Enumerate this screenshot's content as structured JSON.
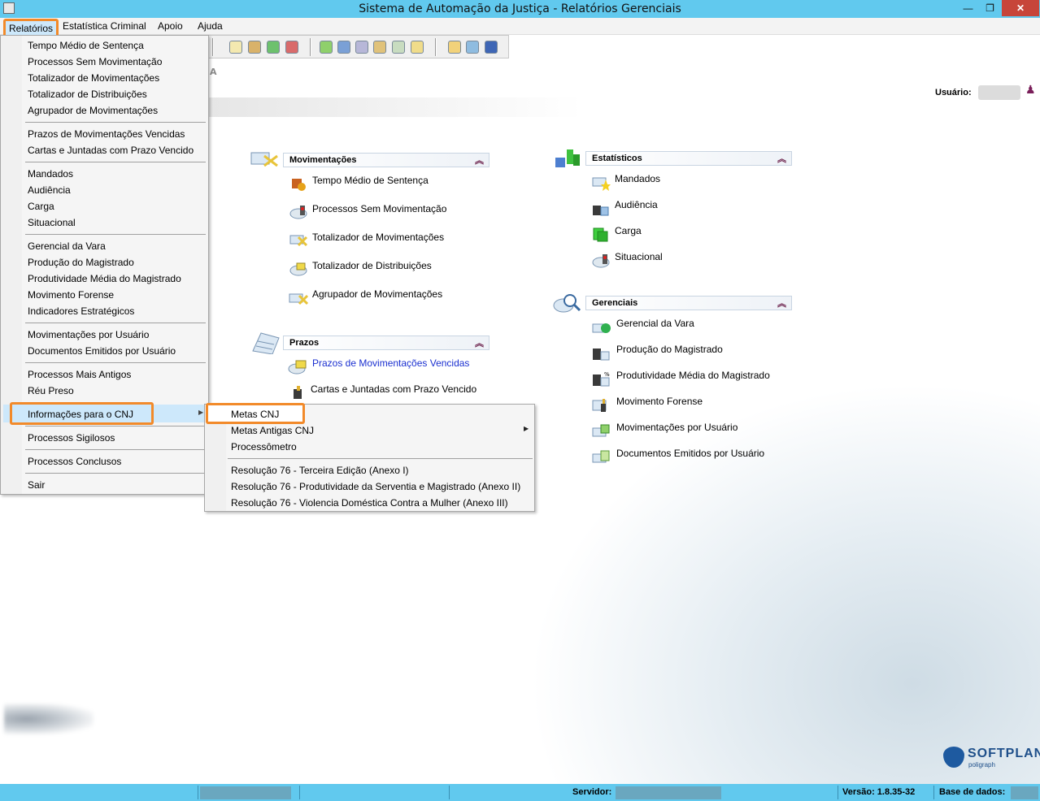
{
  "window": {
    "title": "Sistema de Automação da Justiça - Relatórios Gerenciais",
    "controls": {
      "minimize": "—",
      "maximize": "❐",
      "close": "✕"
    }
  },
  "menubar": {
    "items": [
      "Relatórios",
      "Estatística Criminal",
      "Apoio",
      "Ajuda"
    ]
  },
  "header": {
    "letter": "A",
    "user_label": "Usuário:"
  },
  "dropdown": {
    "groups": [
      [
        "Tempo Médio de Sentença",
        "Processos Sem Movimentação",
        "Totalizador de Movimentações",
        "Totalizador de Distribuições",
        "Agrupador de Movimentações"
      ],
      [
        "Prazos de Movimentações Vencidas",
        "Cartas e Juntadas com Prazo Vencido"
      ],
      [
        "Mandados",
        "Audiência",
        "Carga",
        "Situacional"
      ],
      [
        "Gerencial da Vara",
        "Produção do Magistrado",
        "Produtividade Média do Magistrado",
        "Movimento Forense",
        "Indicadores Estratégicos"
      ],
      [
        "Movimentações por Usuário",
        "Documentos Emitidos por Usuário"
      ],
      [
        "Processos Mais Antigos",
        "Réu Preso"
      ],
      [
        "Informações para o CNJ"
      ],
      [
        "Processos Sigilosos"
      ],
      [
        "Processos Conclusos"
      ],
      [
        "Sair"
      ]
    ]
  },
  "submenu": {
    "items": [
      "Metas CNJ",
      "Metas Antigas CNJ",
      "Processômetro"
    ],
    "resolutions": [
      "Resolução 76 - Terceira Edição (Anexo I)",
      "Resolução 76 - Produtividade da Serventia e Magistrado (Anexo II)",
      "Resolução 76 - Violencia Doméstica Contra a Mulher (Anexo III)"
    ],
    "arrow": "▶"
  },
  "sections": {
    "movimentacoes": {
      "title": "Movimentações",
      "items": [
        "Tempo Médio de Sentença",
        "Processos Sem Movimentação",
        "Totalizador de Movimentações",
        "Totalizador de Distribuições",
        "Agrupador de Movimentações"
      ]
    },
    "prazos": {
      "title": "Prazos",
      "items": [
        "Prazos de Movimentações Vencidas",
        "Cartas e Juntadas com Prazo Vencido"
      ]
    },
    "estatisticos": {
      "title": "Estatísticos",
      "items": [
        "Mandados",
        "Audiência",
        "Carga",
        "Situacional"
      ]
    },
    "gerenciais": {
      "title": "Gerenciais",
      "items": [
        "Gerencial da Vara",
        "Produção do Magistrado",
        "Produtividade Média do Magistrado",
        "Movimento Forense",
        "Movimentações por Usuário",
        "Documentos Emitidos por Usuário"
      ]
    },
    "collapse_glyph": "︽"
  },
  "statusbar": {
    "servidor_label": "Servidor:",
    "versao_label": "Versão: 1.8.35-32",
    "base_label": "Base de dados:"
  },
  "logo": {
    "brand": "SOFTPLAN",
    "sub": "poligraph"
  },
  "colors": {
    "titlebar": "#61c9ee",
    "highlight_border": "#f28a2a",
    "menu_highlight": "#cde8fb",
    "link_blue": "#1a2fd0"
  }
}
